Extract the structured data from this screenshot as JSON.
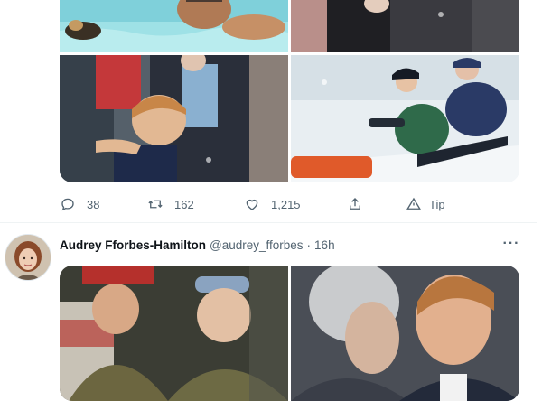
{
  "tweet_previous": {
    "actions": {
      "reply_count": "38",
      "retweet_count": "162",
      "like_count": "1,215",
      "tip_label": "Tip"
    },
    "icons": [
      "reply-icon",
      "retweet-icon",
      "like-icon",
      "share-icon",
      "tip-icon"
    ]
  },
  "tweet_current": {
    "author": {
      "display_name": "Audrey Fforbes-Hamilton",
      "handle": "@audrey_fforbes",
      "separator": "·",
      "time": "16h"
    },
    "more_label": "···"
  },
  "colors": {
    "text_primary": "#0f1419",
    "text_secondary": "#536471",
    "divider": "#eff3f4"
  }
}
